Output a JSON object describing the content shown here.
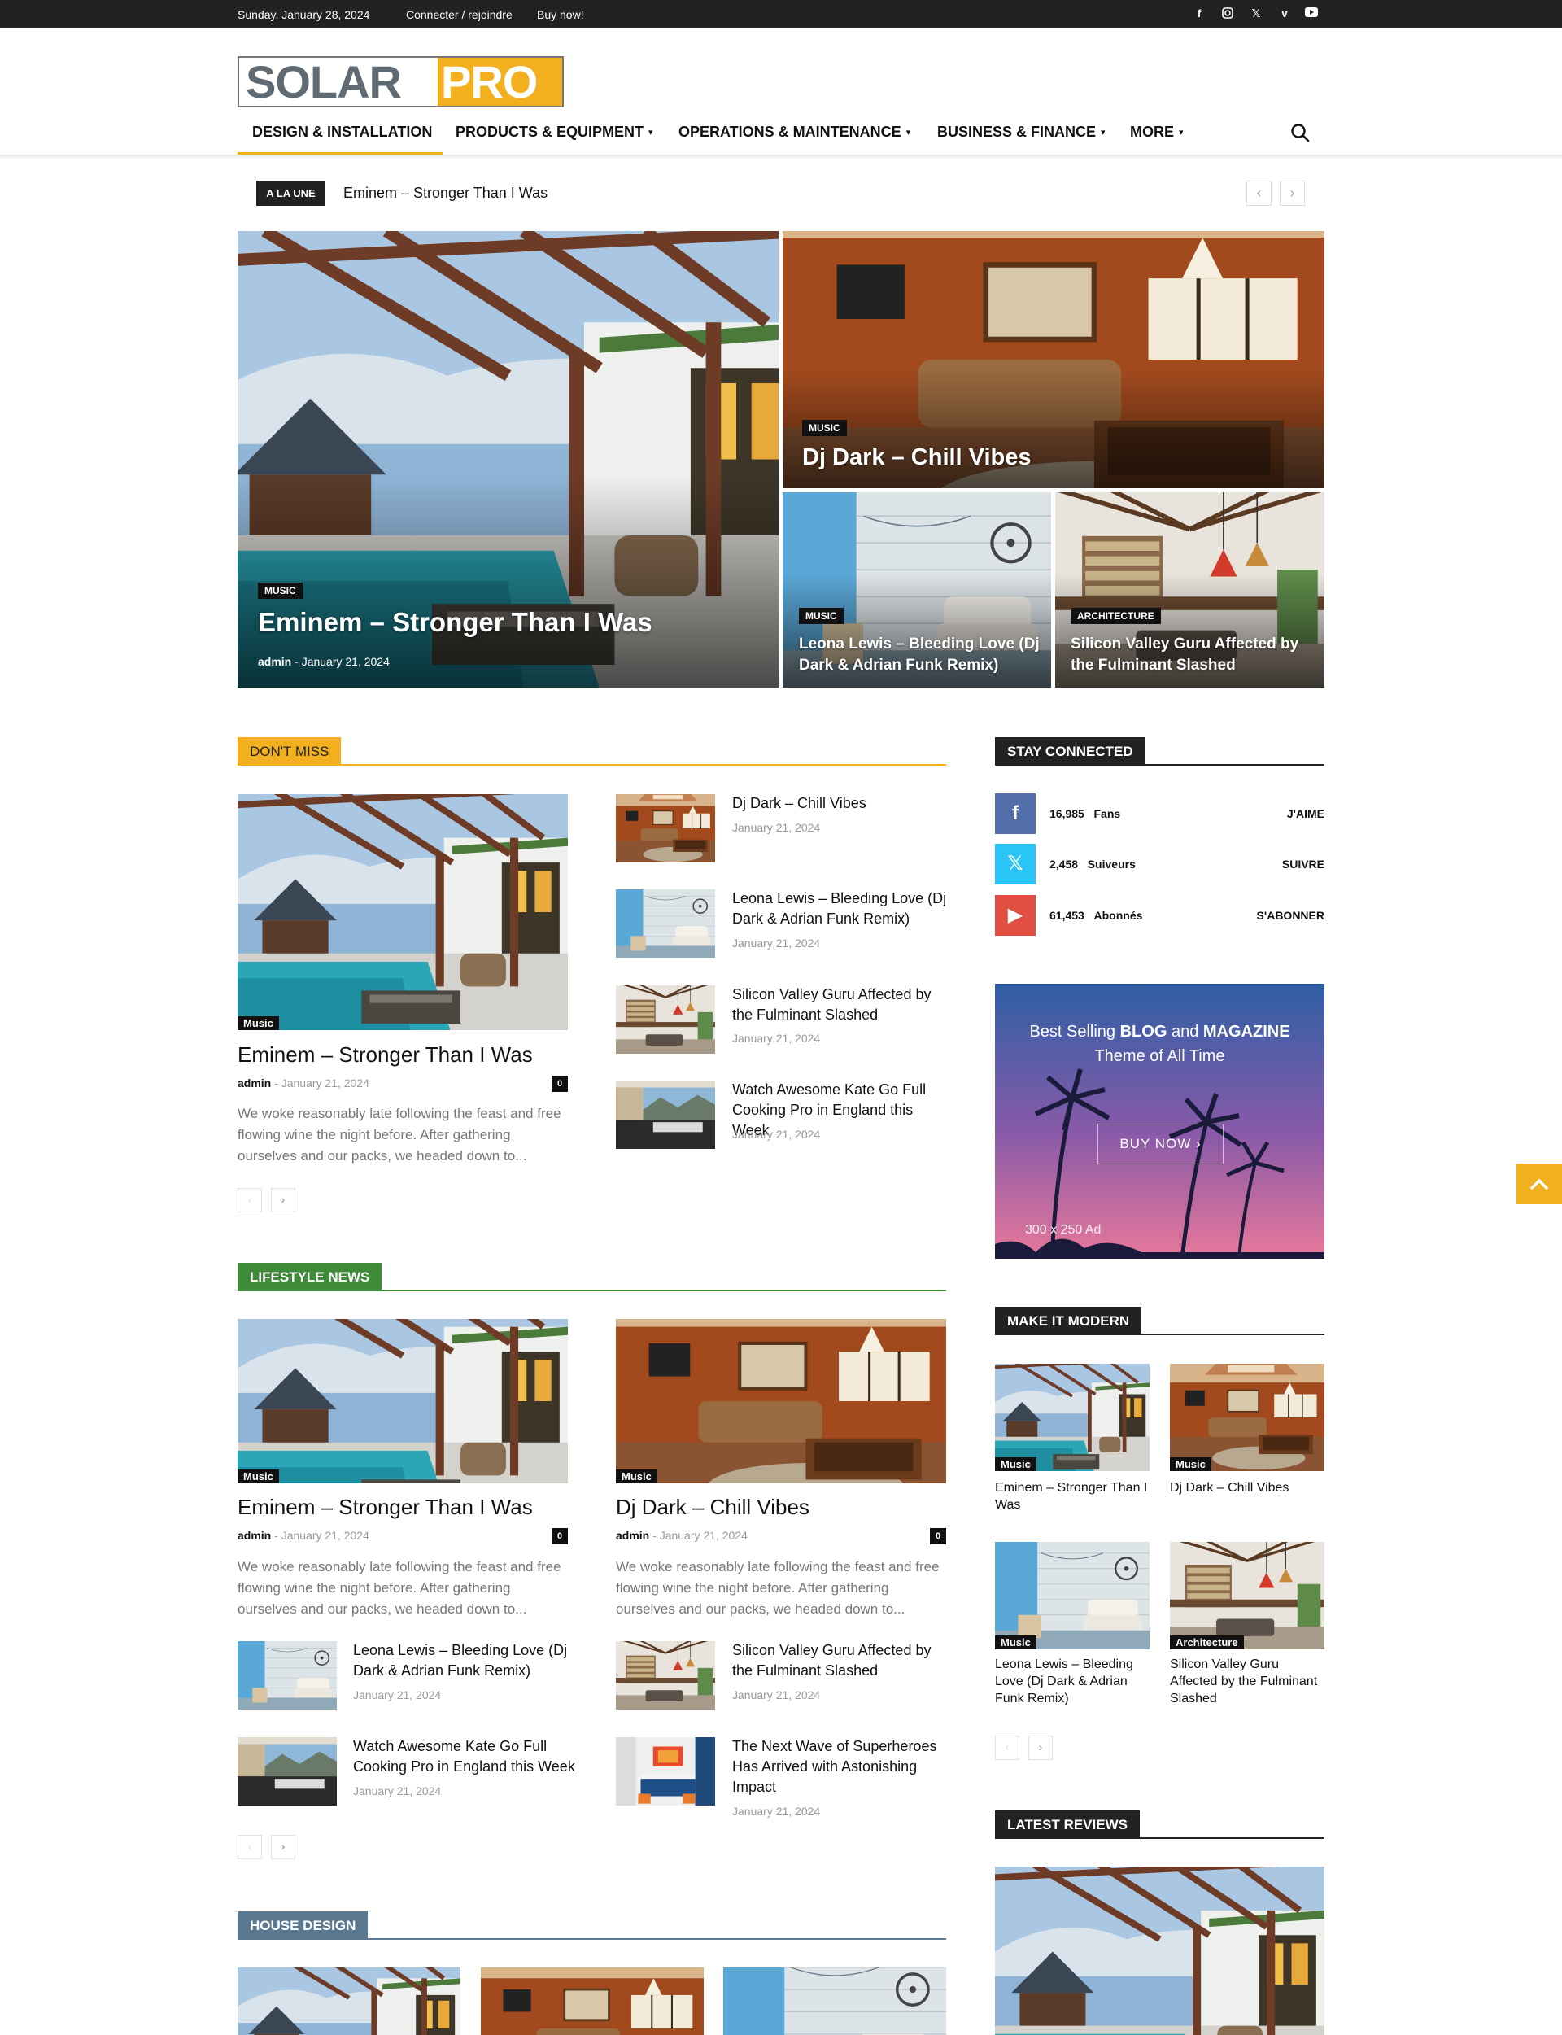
{
  "topbar": {
    "date": "Sunday, January 28, 2024",
    "login": "Connecter / rejoindre",
    "buy": "Buy now!",
    "social_icons": [
      "facebook-icon",
      "instagram-icon",
      "x-icon",
      "vimeo-icon",
      "youtube-icon"
    ]
  },
  "logo": {
    "part1": "SOLAR",
    "part2": "PRO"
  },
  "nav": {
    "items": [
      {
        "label": "DESIGN & INSTALLATION",
        "dropdown": false
      },
      {
        "label": "PRODUCTS & EQUIPMENT",
        "dropdown": true
      },
      {
        "label": "OPERATIONS & MAINTENANCE",
        "dropdown": true
      },
      {
        "label": "BUSINESS & FINANCE",
        "dropdown": true
      },
      {
        "label": "MORE",
        "dropdown": true
      }
    ],
    "active_index": 0
  },
  "ticker": {
    "badge": "A LA UNE",
    "text": "Eminem – Stronger Than I Was",
    "prev": "‹",
    "next": "›"
  },
  "hero": {
    "main": {
      "category": "MUSIC",
      "title": "Eminem – Stronger Than I Was",
      "author": "admin",
      "date": "January 21, 2024"
    },
    "top_right": {
      "category": "MUSIC",
      "title": "Dj Dark – Chill Vibes"
    },
    "bottom_left": {
      "category": "MUSIC",
      "title": "Leona Lewis – Bleeding Love (Dj Dark & Adrian Funk Remix)"
    },
    "bottom_right": {
      "category": "ARCHITECTURE",
      "title": "Silicon Valley Guru Affected by the Fulminant Slashed"
    }
  },
  "dont_miss": {
    "heading": "DON'T MISS",
    "accent": "#f2b01e",
    "featured": {
      "category": "Music",
      "title": "Eminem – Stronger Than I Was",
      "author": "admin",
      "date": "January 21, 2024",
      "comments": "0",
      "excerpt": "We woke reasonably late following the feast and free flowing wine the night before. After gathering ourselves and our packs, we headed down to..."
    },
    "list": [
      {
        "title": "Dj Dark – Chill Vibes",
        "date": "January 21, 2024"
      },
      {
        "title": "Leona Lewis – Bleeding Love (Dj Dark & Adrian Funk Remix)",
        "date": "January 21, 2024"
      },
      {
        "title": "Silicon Valley Guru Affected by the Fulminant Slashed",
        "date": "January 21, 2024"
      },
      {
        "title": "Watch Awesome Kate Go Full Cooking Pro in England this Week",
        "date": "January 21, 2024"
      }
    ],
    "prev": "‹",
    "next": "›"
  },
  "lifestyle": {
    "heading": "LIFESTYLE NEWS",
    "accent": "#3d8b37",
    "featured": [
      {
        "category": "Music",
        "title": "Eminem – Stronger Than I Was",
        "author": "admin",
        "date": "January 21, 2024",
        "comments": "0",
        "excerpt": "We woke reasonably late following the feast and free flowing wine the night before. After gathering ourselves and our packs, we headed down to..."
      },
      {
        "category": "Music",
        "title": "Dj Dark – Chill Vibes",
        "author": "admin",
        "date": "January 21, 2024",
        "comments": "0",
        "excerpt": "We woke reasonably late following the feast and free flowing wine the night before. After gathering ourselves and our packs, we headed down to..."
      }
    ],
    "list": [
      {
        "title": "Leona Lewis – Bleeding Love (Dj Dark & Adrian Funk Remix)",
        "date": "January 21, 2024"
      },
      {
        "title": "Silicon Valley Guru Affected by the Fulminant Slashed",
        "date": "January 21, 2024"
      },
      {
        "title": "Watch Awesome Kate Go Full Cooking Pro in England this Week",
        "date": "January 21, 2024"
      },
      {
        "title": "The Next Wave of Superheroes Has Arrived with Astonishing Impact",
        "date": "January 21, 2024"
      }
    ],
    "prev": "‹",
    "next": "›"
  },
  "house_design": {
    "heading": "HOUSE DESIGN",
    "accent": "#5a7890"
  },
  "sidebar": {
    "stay_connected": {
      "heading": "STAY CONNECTED",
      "rows": [
        {
          "icon": "facebook-icon",
          "count": "16,985",
          "label": "Fans",
          "action": "J'AIME",
          "color": "#516eab"
        },
        {
          "icon": "x-icon",
          "count": "2,458",
          "label": "Suiveurs",
          "action": "SUIVRE",
          "color": "#29c5f6"
        },
        {
          "icon": "youtube-icon",
          "count": "61,453",
          "label": "Abonnés",
          "action": "S'ABONNER",
          "color": "#e14e42"
        }
      ]
    },
    "ad": {
      "line1a": "Best Selling ",
      "line1b": "BLOG",
      "line1c": " and ",
      "line1d": "MAGAZINE",
      "line2": "Theme of All Time",
      "button": "BUY NOW ›",
      "size": "300 x 250 Ad"
    },
    "make_modern": {
      "heading": "MAKE IT MODERN",
      "items": [
        {
          "category": "Music",
          "title": "Eminem – Stronger Than I Was"
        },
        {
          "category": "Music",
          "title": "Dj Dark – Chill Vibes"
        },
        {
          "category": "Music",
          "title": "Leona Lewis – Bleeding Love (Dj Dark & Adrian Funk Remix)"
        },
        {
          "category": "Architecture",
          "title": "Silicon Valley Guru Affected by the Fulminant Slashed"
        }
      ],
      "prev": "‹",
      "next": "›"
    },
    "latest_reviews": {
      "heading": "LATEST REVIEWS"
    }
  },
  "back_to_top": "^"
}
